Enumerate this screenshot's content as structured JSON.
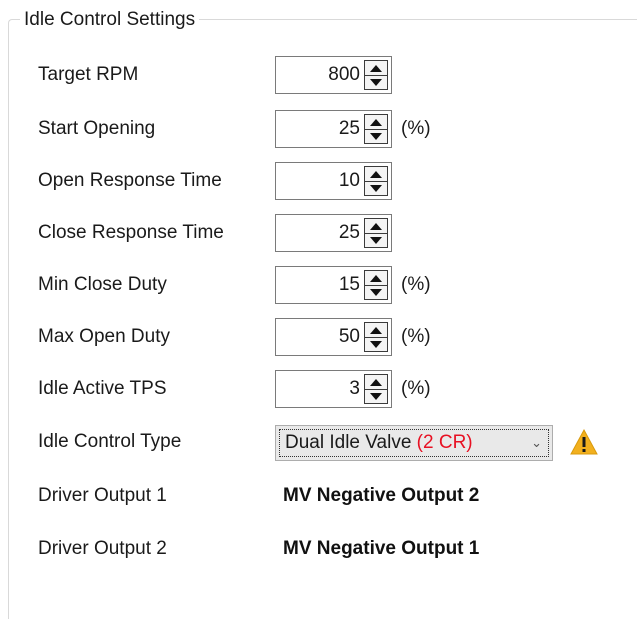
{
  "group": {
    "title": "Idle Control Settings"
  },
  "settings": [
    {
      "label": "Target RPM",
      "value": "800",
      "unit": ""
    },
    {
      "label": "Start Opening",
      "value": "25",
      "unit": "(%)"
    },
    {
      "label": "Open Response Time",
      "value": "10",
      "unit": ""
    },
    {
      "label": "Close Response Time",
      "value": "25",
      "unit": ""
    },
    {
      "label": "Min Close Duty",
      "value": "15",
      "unit": "(%)"
    },
    {
      "label": "Max Open Duty",
      "value": "50",
      "unit": "(%)"
    },
    {
      "label": "Idle Active TPS",
      "value": "3",
      "unit": "(%)"
    }
  ],
  "idle_control_type": {
    "label": "Idle Control Type",
    "selected": "Dual Idle Valve",
    "selected_suffix": "(2 CR)",
    "suffix_color": "#e81123",
    "warning_icon": "warning-triangle-icon",
    "warning_color": "#f2b01e"
  },
  "drivers": [
    {
      "label": "Driver Output 1",
      "value": "MV Negative Output 2"
    },
    {
      "label": "Driver Output 2",
      "value": "MV Negative Output 1"
    }
  ]
}
